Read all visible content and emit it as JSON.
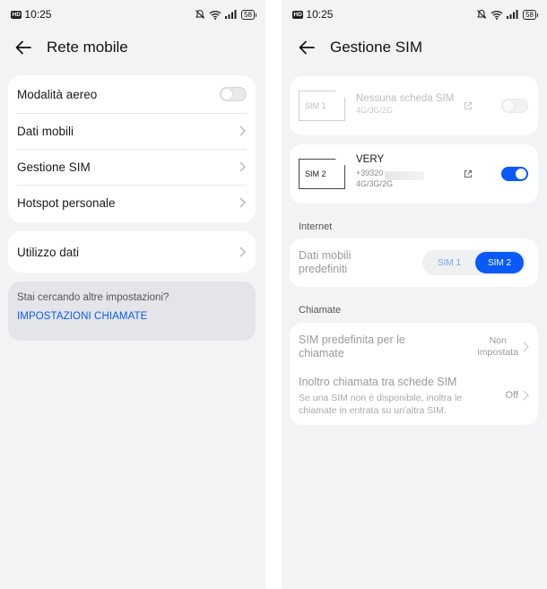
{
  "left": {
    "status": {
      "hd": "HD",
      "time": "10:25",
      "battery": "58"
    },
    "header": {
      "title": "Rete mobile"
    },
    "group1": [
      {
        "label": "Modalità aereo"
      },
      {
        "label": "Dati mobili"
      },
      {
        "label": "Gestione SIM"
      },
      {
        "label": "Hotspot personale"
      }
    ],
    "group2": [
      {
        "label": "Utilizzo dati"
      }
    ],
    "hint": {
      "question": "Stai cercando altre impostazioni?",
      "link": "IMPOSTAZIONI CHIAMATE"
    }
  },
  "right": {
    "status": {
      "hd": "HD",
      "time": "10:25",
      "battery": "58"
    },
    "header": {
      "title": "Gestione SIM"
    },
    "sim1": {
      "card_label": "SIM 1",
      "name": "Nessuna scheda SIM",
      "networks": "4G/3G/2G",
      "enabled": false
    },
    "sim2": {
      "card_label": "SIM 2",
      "name": "VERY",
      "number": "+39320",
      "networks": "4G/3G/2G",
      "enabled": true
    },
    "internet": {
      "section": "Internet",
      "label_line1": "Dati mobili",
      "label_line2": "predefiniti",
      "options": [
        "SIM 1",
        "SIM 2"
      ],
      "selected": "SIM 2"
    },
    "calls": {
      "section": "Chiamate",
      "default_sim_line1": "SIM predefinita per le",
      "default_sim_line2": "chiamate",
      "default_sim_value_line1": "Non",
      "default_sim_value_line2": "impostata",
      "forward_title": "Inoltro chiamata tra schede SIM",
      "forward_desc_line1": "Se una SIM non è disponibile, inoltra le",
      "forward_desc_line2": "chiamate in entrata su un'altra SIM.",
      "forward_value": "Off"
    }
  },
  "colors": {
    "accent": "#0a59f7",
    "background": "#f1f3f5"
  },
  "icons": [
    "back-arrow-icon",
    "chevron-right-icon",
    "wifi-icon",
    "signal-icon",
    "mute-icon",
    "battery-icon",
    "external-link-icon"
  ]
}
